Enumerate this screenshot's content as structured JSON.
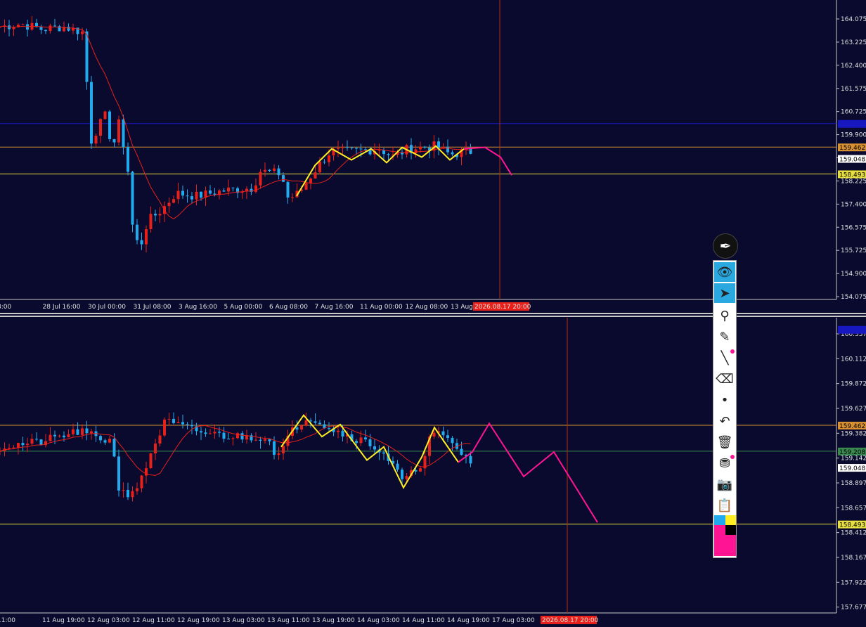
{
  "colors": {
    "background": "#0a0a2e",
    "bull": "#e8201a",
    "bear": "#22aaee",
    "ma": "#e8201a",
    "zigzag": "#ffee22",
    "projection": "#ff1493",
    "level_orange": "#d89030",
    "level_yellow": "#e8e040",
    "level_blue": "#1818c0",
    "level_green": "#3a8a50",
    "vline": "#b03010"
  },
  "chart_data": [
    {
      "type": "candlestick",
      "name": "pane-upper",
      "y_ticks": [
        "164.075",
        "163.225",
        "162.400",
        "161.575",
        "160.725",
        "159.900",
        "159.048",
        "158.225",
        "157.400",
        "156.575",
        "155.725",
        "154.900",
        "154.075"
      ],
      "ylim": [
        154.075,
        164.075
      ],
      "x_labels": [
        "8:00",
        "28 Jul 16:00",
        "30 Jul 00:00",
        "31 Jul 08:00",
        "3 Aug 16:00",
        "5 Aug 00:00",
        "6 Aug 08:00",
        "7 Aug 16:00",
        "11 Aug 00:00",
        "12 Aug 08:00",
        "13 Aug 16:00"
      ],
      "cursor_time_label": "2026.08.17 20:00",
      "price_badges": [
        {
          "text": "159.462",
          "bg": "#d89030",
          "fg": "#000000",
          "value": 159.462
        },
        {
          "text": "158.493",
          "bg": "#e8e040",
          "fg": "#000000",
          "value": 158.493
        },
        {
          "text": "159.048",
          "bg": "#ffffff",
          "fg": "#000000",
          "value": 159.048
        },
        {
          "text": "160.310",
          "bg": "#1818c0",
          "fg": "#1818c0",
          "value": 160.31
        }
      ],
      "levels": [
        160.31,
        159.462,
        158.493
      ]
    },
    {
      "type": "candlestick",
      "name": "pane-lower",
      "y_ticks": [
        "160.357",
        "160.112",
        "159.872",
        "159.627",
        "159.382",
        "159.142",
        "158.897",
        "158.657",
        "158.412",
        "158.167",
        "157.922",
        "157.677",
        "157.437"
      ],
      "ylim": [
        157.437,
        160.357
      ],
      "x_labels": [
        "11:00",
        "11 Aug 19:00",
        "12 Aug 03:00",
        "12 Aug 11:00",
        "12 Aug 19:00",
        "13 Aug 03:00",
        "13 Aug 11:00",
        "13 Aug 19:00",
        "14 Aug 03:00",
        "14 Aug 11:00",
        "14 Aug 19:00",
        "17 Aug 03:00"
      ],
      "cursor_time_label": "2026.08.17 20:00",
      "price_badges": [
        {
          "text": "159.462",
          "bg": "#d89030",
          "fg": "#000000",
          "value": 159.462
        },
        {
          "text": "159.208",
          "bg": "#3a8a50",
          "fg": "#000000",
          "value": 159.208
        },
        {
          "text": "159.048",
          "bg": "#ffffff",
          "fg": "#000000",
          "value": 159.048
        },
        {
          "text": "158.493",
          "bg": "#e8e040",
          "fg": "#000000",
          "value": 158.493
        },
        {
          "text": "160.400",
          "bg": "#1818c0",
          "fg": "#1818c0",
          "value": 160.4
        }
      ],
      "levels": [
        159.462,
        159.208,
        158.493
      ]
    }
  ],
  "toolbar": {
    "items": [
      {
        "name": "pen-logo-icon",
        "glyph": "✒"
      },
      {
        "name": "eye-icon",
        "glyph": "👁"
      },
      {
        "name": "cursor-arrow-icon",
        "glyph": "➤"
      },
      {
        "name": "magnet-icon",
        "glyph": "⚲"
      },
      {
        "name": "eraser-pen-icon",
        "glyph": "✎"
      },
      {
        "name": "line-tool-icon",
        "glyph": "╲"
      },
      {
        "name": "eraser-icon",
        "glyph": "⌫"
      },
      {
        "name": "dot-icon",
        "glyph": "•"
      },
      {
        "name": "undo-icon",
        "glyph": "↶"
      },
      {
        "name": "trash-icon",
        "glyph": "🗑"
      },
      {
        "name": "paint-bucket-icon",
        "glyph": "⛃"
      },
      {
        "name": "camera-icon",
        "glyph": "📷"
      },
      {
        "name": "clipboard-icon",
        "glyph": "📋"
      }
    ]
  }
}
